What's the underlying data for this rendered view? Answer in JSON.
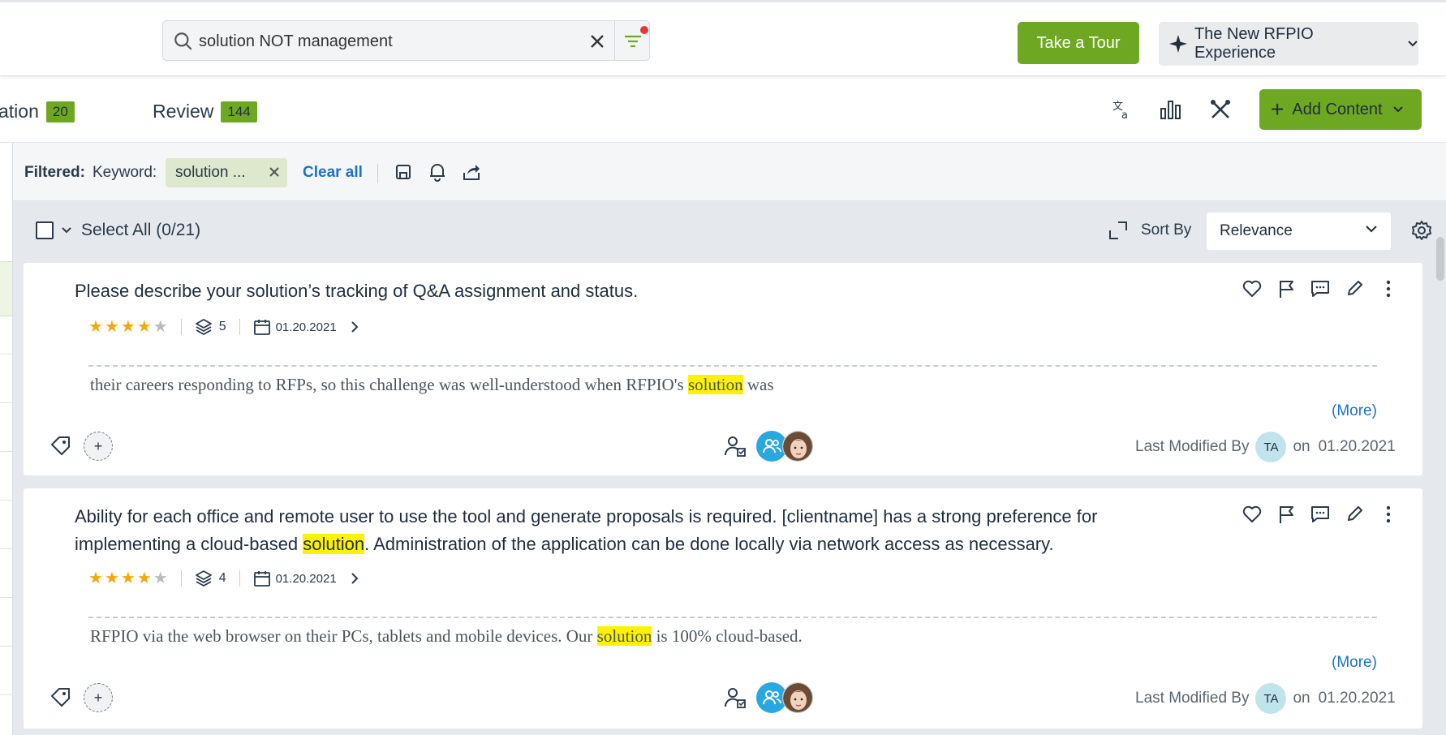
{
  "search": {
    "value": "solution NOT management"
  },
  "header": {
    "tour_label": "Take a Tour",
    "experience_label": "The New RFPIO Experience"
  },
  "tabs": [
    {
      "label": "ation",
      "count": "20"
    },
    {
      "label": "Review",
      "count": "144"
    }
  ],
  "toolbar": {
    "add_content_label": "Add Content"
  },
  "filter": {
    "filtered_label": "Filtered:",
    "keyword_label": "Keyword:",
    "keyword_chip": "solution ...",
    "clear_all": "Clear all"
  },
  "list": {
    "select_all": "Select All (0/21)",
    "sort_by_label": "Sort By",
    "sort_value": "Relevance"
  },
  "cards": [
    {
      "question": "Please describe your solution’s tracking of Q&A assignment and status.",
      "rating": 4,
      "versions": "5",
      "date": "01.20.2021",
      "answer_pre": "their careers responding to RFPs, so this challenge was well-understood when RFPIO's ",
      "answer_hl": "solution",
      "answer_post": " was",
      "more": "(More)",
      "add_tag": "+",
      "last_modified_label": "Last Modified By",
      "user_initials": "TA",
      "on_label": "on",
      "modified_date": "01.20.2021"
    },
    {
      "question_pre": "Ability for each office and remote user to use the tool and generate proposals is required.  [clientname] has a strong preference for implementing a cloud-based ",
      "question_hl": "solution",
      "question_post": ".  Administration of the application can be done locally via network access as necessary.",
      "rating": 4,
      "versions": "4",
      "date": "01.20.2021",
      "answer_pre": "RFPIO via the web browser on their PCs, tablets and mobile devices. Our ",
      "answer_hl": "solution",
      "answer_post": " is 100% cloud-based.",
      "more": "(More)",
      "add_tag": "+",
      "last_modified_label": "Last Modified By",
      "user_initials": "TA",
      "on_label": "on",
      "modified_date": "01.20.2021"
    }
  ],
  "colors": {
    "accent_green": "#6ea822",
    "link_blue": "#1a73c9",
    "highlight": "#fff200",
    "star": "#f4a80b"
  }
}
